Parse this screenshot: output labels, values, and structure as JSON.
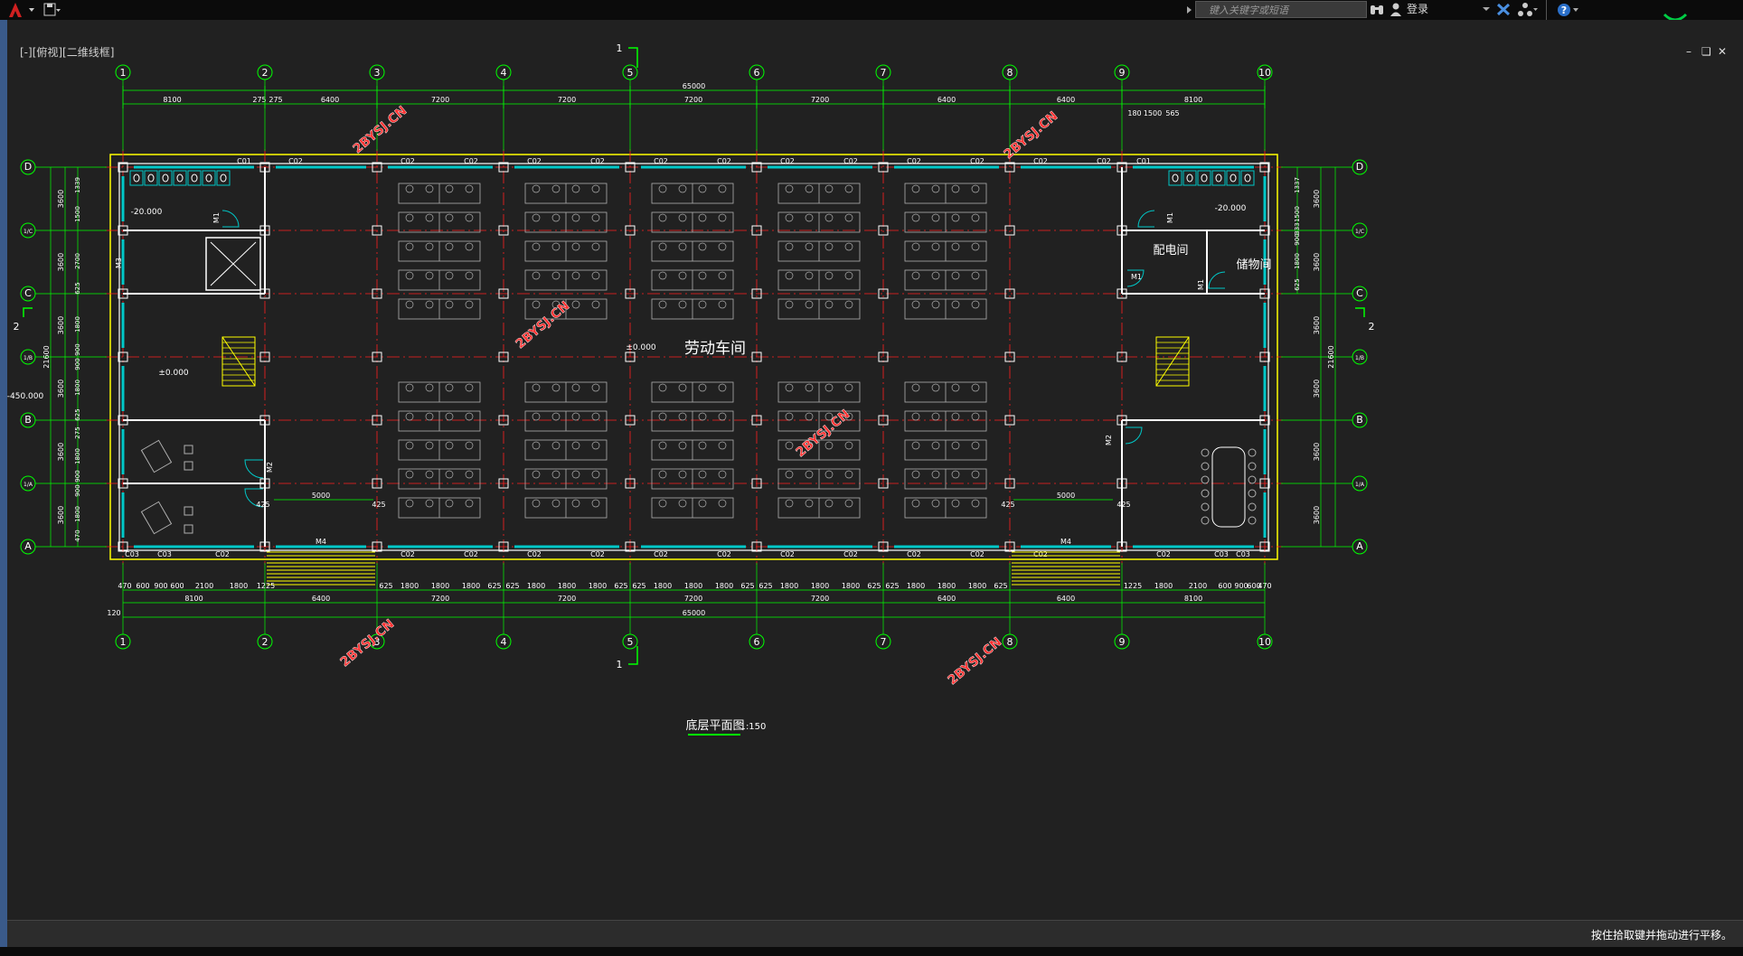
{
  "toolbar": {
    "search_placeholder": "键入关键字或短语",
    "login_label": "登录"
  },
  "viewport": {
    "label": "[-][俯视][二维线框]"
  },
  "plan": {
    "axis_numbers": [
      "1",
      "2",
      "3",
      "4",
      "5",
      "6",
      "7",
      "8",
      "9",
      "10"
    ],
    "axis_letters": [
      "D",
      "1/C",
      "C",
      "1/B",
      "B",
      "1/A",
      "A"
    ],
    "overall_dim": "65000",
    "top_dims": [
      "8100",
      "275",
      "275",
      "6400",
      "7200",
      "7200",
      "7200",
      "7200",
      "6400",
      "8100"
    ],
    "top_right_small": [
      "180",
      "1500",
      "565"
    ],
    "bottom_dims_mid": [
      "8100",
      "6400",
      "7200",
      "7200",
      "7200",
      "7200",
      "6400",
      "8100"
    ],
    "bottom_detail_left": [
      "470",
      "600",
      "900",
      "600",
      "2100",
      "1800",
      "1225"
    ],
    "bottom_detail_bay": [
      "625",
      "1800",
      "1800",
      "1800",
      "625"
    ],
    "bottom_detail_right": [
      "1225",
      "1800",
      "2100",
      "600",
      "900",
      "600",
      "470"
    ],
    "left_dims": [
      "3600",
      "3600",
      "3600",
      "3600",
      "3600",
      "3600"
    ],
    "left_detail": [
      "1339",
      "1500",
      "2700",
      "625",
      "1800",
      "900",
      "900",
      "1800",
      "625",
      "275",
      "1800",
      "900",
      "900",
      "1800",
      "470"
    ],
    "overall_height": "21600",
    "left_120": "120",
    "right_dims": [
      "3600",
      "3600",
      "3600",
      "3600",
      "3600",
      "3600"
    ],
    "right_detail": [
      "1337",
      "1500",
      "900",
      "1800",
      "625",
      "333"
    ],
    "window_labels": [
      "C01",
      "C02",
      "C03"
    ],
    "door_labels": [
      "M1",
      "M2",
      "M3",
      "M4"
    ],
    "room_workshop": "劳动车间",
    "room_power": "配电间",
    "room_storage": "储物间",
    "elev_main": "±0.000",
    "elev_left": "±0.000",
    "elev_wc_left": "-20.000",
    "elev_wc_right": "-20.000",
    "elev_outside": "-450.000",
    "dim_5000": "5000",
    "dim_425": "425",
    "section_1": "1",
    "section_2": "2",
    "title": "底层平面图",
    "scale": "1:150",
    "watermark": "2BYSJ.CN"
  },
  "status": {
    "text": "按住拾取键并拖动进行平移。"
  },
  "colors": {
    "bg": "#212121",
    "axis": "#ff2020",
    "dim": "#00ff00",
    "wall": "#ffffff",
    "window": "#00c8c8",
    "stair": "#ffff00",
    "furniture": "#b0b0b0",
    "watermark": "#ff3030"
  }
}
